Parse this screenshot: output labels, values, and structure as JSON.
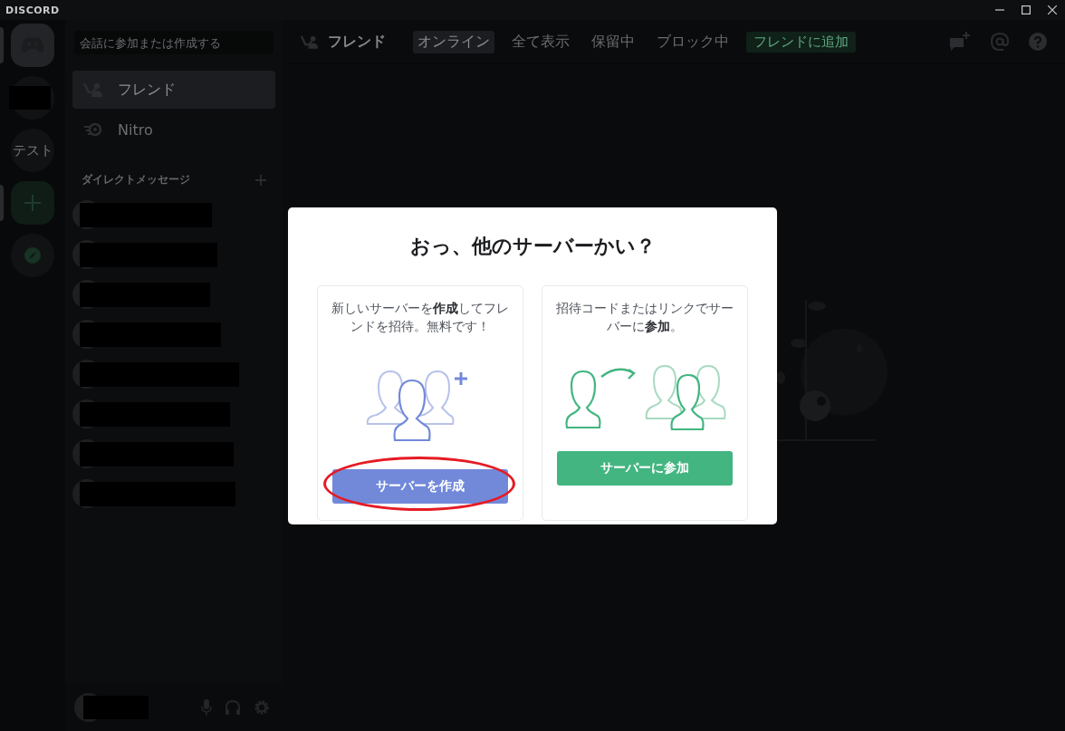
{
  "window": {
    "title": "DISCORD"
  },
  "servers": [
    {
      "kind": "home",
      "selected": true
    },
    {
      "kind": "redacted",
      "selected": false
    },
    {
      "kind": "text",
      "label": "テスト",
      "selected": false
    },
    {
      "kind": "add",
      "selected": true
    },
    {
      "kind": "explore",
      "selected": false
    }
  ],
  "search": {
    "placeholder": "会話に参加または作成する"
  },
  "nav": [
    {
      "kind": "friends",
      "label": "フレンド",
      "selected": true
    },
    {
      "kind": "nitro",
      "label": "Nitro",
      "selected": false
    }
  ],
  "dm_header": {
    "label": "ダイレクトメッセージ"
  },
  "dm_items": [
    {
      "kind": "redacted"
    },
    {
      "kind": "redacted"
    },
    {
      "kind": "redacted"
    },
    {
      "kind": "redacted"
    },
    {
      "kind": "redacted"
    },
    {
      "kind": "redacted"
    },
    {
      "kind": "redacted"
    },
    {
      "kind": "redacted"
    }
  ],
  "user_panel": {
    "kind": "redacted"
  },
  "header": {
    "title": "フレンド",
    "tabs": [
      {
        "label": "オンライン",
        "selected": true
      },
      {
        "label": "全て表示",
        "selected": false
      },
      {
        "label": "保留中",
        "selected": false
      },
      {
        "label": "ブロック中",
        "selected": false
      }
    ],
    "add_friend": "フレンドに追加"
  },
  "modal": {
    "title": "おっ、他のサーバーかい？",
    "options": [
      {
        "kind": "create",
        "text": "新しいサーバーを**作成**してフレンドを招待。無料です！",
        "button": "サーバーを作成",
        "highlighted": true
      },
      {
        "kind": "join",
        "text": "招待コードまたはリンクでサーバーに**参加**。",
        "button": "サーバーに参加",
        "highlighted": false
      }
    ]
  }
}
